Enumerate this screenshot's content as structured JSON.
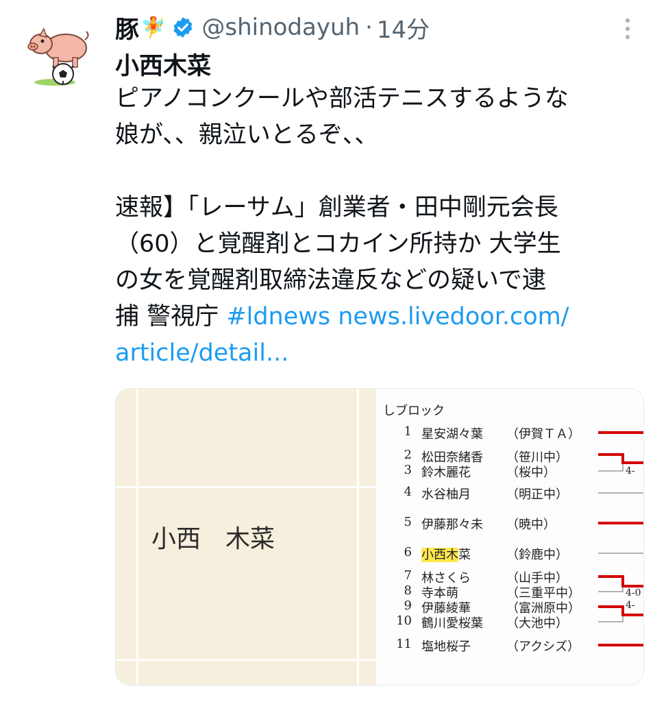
{
  "user": {
    "display_name": "豚",
    "emoji": "🧚",
    "handle": "@shinodayuh",
    "separator": "·",
    "time": "14分"
  },
  "post": {
    "subject": "小西木菜",
    "lines": [
      "ピアノコンクールや部活テニスするような",
      "娘が、、親泣いとるぞ、、"
    ],
    "news_lines": [
      "速報】「レーサム」創業者・田中剛元会長",
      "（60）と覚醒剤とコカイン所持か 大学生",
      "の女を覚醒剤取締法違反などの疑いで逮"
    ],
    "last_line_text": "捕 警視庁 ",
    "hashtag": "#ldnews",
    "link_part1": "news.livedoor.com/",
    "link_part2": "article/detail..."
  },
  "media": {
    "paper_name": "小西　木菜",
    "bracket": {
      "title": "しブロック",
      "entries": [
        {
          "num": "1",
          "name": "星安湖々葉",
          "school": "（伊賀ＴＡ）"
        },
        {
          "num": "2",
          "name": "松田奈緒香",
          "school": "（笹川中）"
        },
        {
          "num": "3",
          "name": "鈴木麗花",
          "school": "（桜中）"
        },
        {
          "num": "4",
          "name": "水谷柚月",
          "school": "（明正中）"
        },
        {
          "num": "5",
          "name": "伊藤那々未",
          "school": "（暁中）"
        },
        {
          "num": "6",
          "name_hl": "小西木",
          "name_rest": "菜",
          "school": "（鈴鹿中）"
        },
        {
          "num": "7",
          "name": "林さくら",
          "school": "（山手中）"
        },
        {
          "num": "8",
          "name": "寺本萌",
          "school": "（三重平中）"
        },
        {
          "num": "9",
          "name": "伊藤綾華",
          "school": "（富洲原中）"
        },
        {
          "num": "10",
          "name": "鶴川愛桜葉",
          "school": "（大池中）"
        },
        {
          "num": "11",
          "name": "塩地桜子",
          "school": "（アクシズ）"
        }
      ],
      "scores": [
        "4-",
        "4-0",
        "4-"
      ]
    }
  },
  "colors": {
    "verified": "#1d9bf0",
    "link": "#1d9bf0",
    "bracket_win": "#d40000"
  }
}
